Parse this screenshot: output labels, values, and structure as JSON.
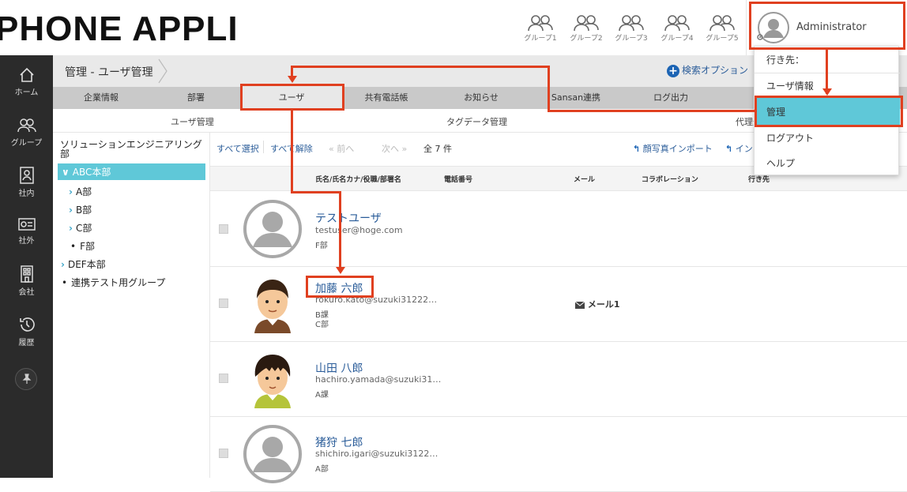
{
  "header": {
    "logo": "PHONE APPLI",
    "groups": [
      "グループ1",
      "グループ2",
      "グループ3",
      "グループ4",
      "グループ5"
    ],
    "user_name": "Administrator"
  },
  "sidebar": {
    "items": [
      {
        "label": "ホーム",
        "icon": "home-icon"
      },
      {
        "label": "グループ",
        "icon": "group-icon"
      },
      {
        "label": "社内",
        "icon": "contact-card-icon"
      },
      {
        "label": "社外",
        "icon": "business-card-icon"
      },
      {
        "label": "会社",
        "icon": "building-icon"
      },
      {
        "label": "履歴",
        "icon": "history-icon"
      }
    ],
    "pin_icon": "pin-icon"
  },
  "breadcrumb": "管理 - ユーザ管理",
  "search_options": "検索オプション",
  "tabs": [
    "企業情報",
    "部署",
    "ユーザ",
    "共有電話帳",
    "お知らせ",
    "Sansan連携",
    "ログ出力"
  ],
  "subtabs": [
    "ユーザ管理",
    "タグデータ管理",
    "代理登"
  ],
  "tree": {
    "root": "ソリューションエンジニアリング部",
    "abc": "ABC本部",
    "a": "A部",
    "b": "B部",
    "c": "C部",
    "f": "F部",
    "def": "DEF本部",
    "linked": "連携テスト用グループ"
  },
  "toolbar": {
    "select_all": "すべて選択",
    "deselect_all": "すべて解除",
    "prev": "前へ",
    "next": "次へ",
    "count": "全 7 件",
    "photo_import": "顔写真インポート",
    "import": "イン"
  },
  "columns": [
    "氏名/氏名カナ/役職/部署名",
    "電話番号",
    "メール",
    "コラボレーション",
    "行き先"
  ],
  "users": [
    {
      "name": "テストユーザ",
      "email": "testuser@hoge.com",
      "dept1": "F部",
      "dept2": "",
      "mail_label": ""
    },
    {
      "name": "加藤 六郎",
      "email": "rokuro.kato@suzuki31222…",
      "dept1": "B課",
      "dept2": "C部",
      "mail_label": "メール1"
    },
    {
      "name": "山田 八郎",
      "email": "hachiro.yamada@suzuki31…",
      "dept1": "A課",
      "dept2": "",
      "mail_label": ""
    },
    {
      "name": "猪狩 七郎",
      "email": "shichiro.igari@suzuki3122…",
      "dept1": "A部",
      "dept2": "",
      "mail_label": ""
    }
  ],
  "dropdown": {
    "destination": "行き先：",
    "user_info": "ユーザ情報",
    "manage": "管理",
    "logout": "ログアウト",
    "help": "ヘルプ"
  },
  "colors": {
    "accent": "#5fc8d8",
    "link": "#2a5c99",
    "annotation": "#e04020",
    "sidebar": "#2b2b2b"
  }
}
